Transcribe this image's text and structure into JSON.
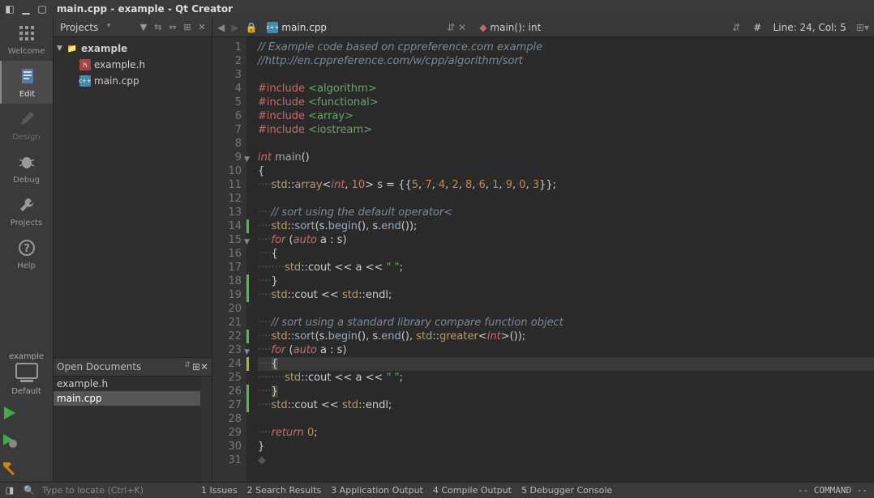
{
  "window": {
    "title": "main.cpp - example - Qt Creator"
  },
  "modes": {
    "welcome": "Welcome",
    "edit": "Edit",
    "design": "Design",
    "debug": "Debug",
    "projects": "Projects",
    "help": "Help"
  },
  "kit": {
    "project": "example",
    "name": "Default"
  },
  "sidebar": {
    "combo": "Projects",
    "tree": {
      "root": "example",
      "items": [
        "example.h",
        "main.cpp"
      ]
    },
    "opendocs_label": "Open Documents",
    "open_docs": [
      "example.h",
      "main.cpp"
    ]
  },
  "editor": {
    "file": "main.cpp",
    "symbol": "main(): int",
    "cursor": "Line: 24, Col: 5",
    "hash": "#",
    "current_line": 24,
    "lines": [
      {
        "n": 1,
        "html": "<span class='tok-cm'>// Example code based on cppreference.com example</span>"
      },
      {
        "n": 2,
        "html": "<span class='tok-cm'>//http://en.cppreference.com/w/cpp/algorithm/sort</span>"
      },
      {
        "n": 3,
        "html": ""
      },
      {
        "n": 4,
        "html": "<span class='tok-pp'>#include</span> <span class='tok-inc'>&lt;algorithm&gt;</span>"
      },
      {
        "n": 5,
        "html": "<span class='tok-pp'>#include</span> <span class='tok-inc'>&lt;functional&gt;</span>"
      },
      {
        "n": 6,
        "html": "<span class='tok-pp'>#include</span> <span class='tok-inc'>&lt;array&gt;</span>"
      },
      {
        "n": 7,
        "html": "<span class='tok-pp'>#include</span> <span class='tok-inc'>&lt;iostream&gt;</span>"
      },
      {
        "n": 8,
        "html": ""
      },
      {
        "n": 9,
        "fold": "▼",
        "html": "<span class='tok-ty'>int</span> <span class='tok-fn'>main</span><span class='tok-pun'>()</span>"
      },
      {
        "n": 10,
        "html": "<span class='tok-pun'>{</span>"
      },
      {
        "n": 11,
        "html": "<span class='tok-dot'>····</span><span class='tok-ns'>std</span><span class='tok-pun'>::</span><span class='tok-ns'>array</span><span class='tok-pun'>&lt;</span><span class='tok-ty'>int</span><span class='tok-pun'>,</span><span class='tok-dot'>·</span><span class='tok-num'>10</span><span class='tok-pun'>&gt;</span> <span class='tok-var'>s</span> <span class='tok-pun'>=</span> <span class='tok-pun'>{{</span><span class='tok-num'>5</span><span class='tok-pun'>,</span><span class='tok-dot'>·</span><span class='tok-num'>7</span><span class='tok-pun'>,</span><span class='tok-dot'>·</span><span class='tok-num'>4</span><span class='tok-pun'>,</span><span class='tok-dot'>·</span><span class='tok-num'>2</span><span class='tok-pun'>,</span><span class='tok-dot'>·</span><span class='tok-num'>8</span><span class='tok-pun'>,</span><span class='tok-dot'>·</span><span class='tok-num'>6</span><span class='tok-pun'>,</span><span class='tok-dot'>·</span><span class='tok-num'>1</span><span class='tok-pun'>,</span><span class='tok-dot'>·</span><span class='tok-num'>9</span><span class='tok-pun'>,</span><span class='tok-dot'>·</span><span class='tok-num'>0</span><span class='tok-pun'>,</span><span class='tok-dot'>·</span><span class='tok-num'>3</span><span class='tok-pun'>}};</span>"
      },
      {
        "n": 12,
        "html": ""
      },
      {
        "n": 13,
        "html": "<span class='tok-dot'>····</span><span class='tok-cm'>// sort using the default operator&lt;</span>"
      },
      {
        "n": 14,
        "edge": "g",
        "html": "<span class='tok-dot'>····</span><span class='tok-ns'>std</span><span class='tok-pun'>::</span><span class='tok-fn'>sort</span><span class='tok-pun'>(</span><span class='tok-var'>s</span><span class='tok-pun'>.</span><span class='tok-fn'>begin</span><span class='tok-pun'>(),</span> <span class='tok-var'>s</span><span class='tok-pun'>.</span><span class='tok-fn'>end</span><span class='tok-pun'>());</span>"
      },
      {
        "n": 15,
        "fold": "▼",
        "html": "<span class='tok-dot'>····</span><span class='tok-kw'>for</span> <span class='tok-pun'>(</span><span class='tok-kw'>auto</span> <span class='tok-var'>a</span> <span class='tok-pun'>:</span> <span class='tok-var'>s</span><span class='tok-pun'>)</span>"
      },
      {
        "n": 16,
        "html": "<span class='tok-dot'>····</span><span class='tok-pun'>{</span>"
      },
      {
        "n": 17,
        "html": "<span class='tok-dot'>········</span><span class='tok-ns'>std</span><span class='tok-pun'>::</span><span class='tok-var'>cout</span> <span class='tok-pun'>&lt;&lt;</span> <span class='tok-var'>a</span> <span class='tok-pun'>&lt;&lt;</span> <span class='tok-str'>\" \"</span><span class='tok-pun'>;</span>"
      },
      {
        "n": 18,
        "edge": "g",
        "html": "<span class='tok-dot'>····</span><span class='tok-pun'>}</span>"
      },
      {
        "n": 19,
        "edge": "g",
        "html": "<span class='tok-dot'>····</span><span class='tok-ns'>std</span><span class='tok-pun'>::</span><span class='tok-var'>cout</span> <span class='tok-pun'>&lt;&lt;</span> <span class='tok-ns'>std</span><span class='tok-pun'>::</span><span class='tok-var'>endl</span><span class='tok-pun'>;</span>"
      },
      {
        "n": 20,
        "html": ""
      },
      {
        "n": 21,
        "html": "<span class='tok-dot'>····</span><span class='tok-cm'>// sort using a standard library compare function object</span>"
      },
      {
        "n": 22,
        "edge": "g",
        "html": "<span class='tok-dot'>····</span><span class='tok-ns'>std</span><span class='tok-pun'>::</span><span class='tok-fn'>sort</span><span class='tok-pun'>(</span><span class='tok-var'>s</span><span class='tok-pun'>.</span><span class='tok-fn'>begin</span><span class='tok-pun'>(),</span> <span class='tok-var'>s</span><span class='tok-pun'>.</span><span class='tok-fn'>end</span><span class='tok-pun'>(),</span> <span class='tok-ns'>std</span><span class='tok-pun'>::</span><span class='tok-ns'>greater</span><span class='tok-pun'>&lt;</span><span class='tok-ty'>int</span><span class='tok-pun'>&gt;());</span>"
      },
      {
        "n": 23,
        "fold": "▼",
        "html": "<span class='tok-dot'>····</span><span class='tok-kw'>for</span> <span class='tok-pun'>(</span><span class='tok-kw'>auto</span> <span class='tok-var'>a</span> <span class='tok-pun'>:</span> <span class='tok-var'>s</span><span class='tok-pun'>)</span>"
      },
      {
        "n": 24,
        "edge": "y",
        "html": "<span class='tok-dot'>····</span><span class='tok-pun tok-mark'>{</span>"
      },
      {
        "n": 25,
        "html": "<span class='tok-dot'>········</span><span class='tok-ns'>std</span><span class='tok-pun'>::</span><span class='tok-var'>cout</span> <span class='tok-pun'>&lt;&lt;</span> <span class='tok-var'>a</span> <span class='tok-pun'>&lt;&lt;</span> <span class='tok-str'>\" \"</span><span class='tok-pun'>;</span>"
      },
      {
        "n": 26,
        "edge": "g",
        "html": "<span class='tok-dot'>····</span><span class='tok-pun tok-mark'>}</span>"
      },
      {
        "n": 27,
        "edge": "g",
        "html": "<span class='tok-dot'>····</span><span class='tok-ns'>std</span><span class='tok-pun'>::</span><span class='tok-var'>cout</span> <span class='tok-pun'>&lt;&lt;</span> <span class='tok-ns'>std</span><span class='tok-pun'>::</span><span class='tok-var'>endl</span><span class='tok-pun'>;</span>"
      },
      {
        "n": 28,
        "html": ""
      },
      {
        "n": 29,
        "html": "<span class='tok-dot'>····</span><span class='tok-kw'>return</span> <span class='tok-num'>0</span><span class='tok-pun'>;</span>"
      },
      {
        "n": 30,
        "html": "<span class='tok-pun'>}</span>"
      },
      {
        "n": 31,
        "html": "<span class='tok-dot'>◆</span>"
      }
    ]
  },
  "status": {
    "locator_placeholder": "Type to locate (Ctrl+K)",
    "panes": [
      "1  Issues",
      "2  Search Results",
      "3  Application Output",
      "4  Compile Output",
      "5  Debugger Console"
    ],
    "vim": "-- COMMAND --"
  }
}
